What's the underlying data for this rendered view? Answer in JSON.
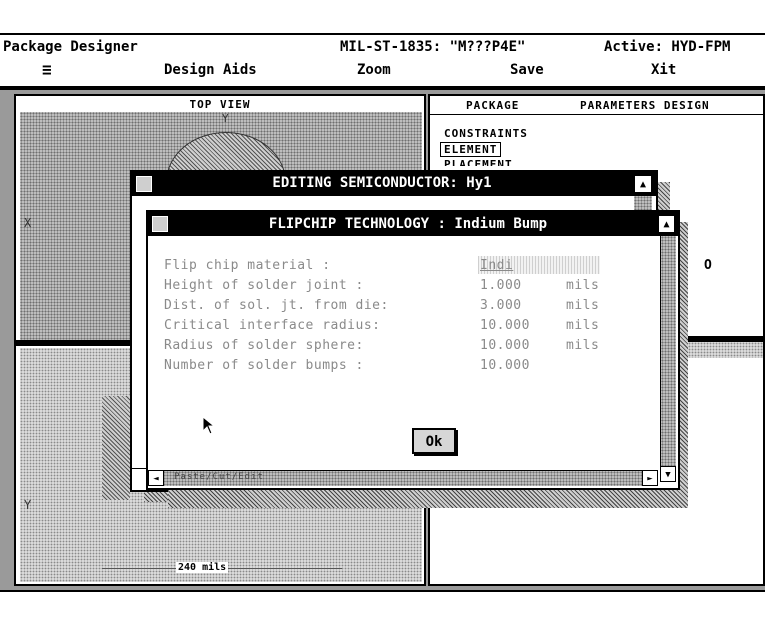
{
  "app": {
    "title": "Package Designer",
    "spec": "MIL-ST-1835: \"M???P4E\"",
    "active": "Active: HYD-FPM"
  },
  "menu": {
    "system_glyph": "≡",
    "items": [
      "Design Aids",
      "Zoom",
      "Save",
      "Xit"
    ]
  },
  "top_view": {
    "title": "TOP VIEW",
    "axis_y_top": "Y",
    "axis_x": "X",
    "axis_y_bottom": "Y",
    "scale": "240 mils"
  },
  "right_panel": {
    "tabs": [
      "PACKAGE",
      "PARAMETERS DESIGN"
    ],
    "items": [
      "CONSTRAINTS",
      "ELEMENT",
      "PLACEMENT"
    ],
    "marker": "O"
  },
  "outer_dialog": {
    "title": "EDITING SEMICONDUCTOR: Hy1",
    "status": "Paste/Cut/Edit"
  },
  "inner_dialog": {
    "title": "FLIPCHIP TECHNOLOGY : Indium Bump",
    "rows": [
      {
        "label": "Flip chip material :",
        "value": "Indi",
        "unit": ""
      },
      {
        "label": "Height of solder joint :",
        "value": "1.000",
        "unit": "mils"
      },
      {
        "label": "Dist. of sol. jt. from die:",
        "value": "3.000",
        "unit": "mils"
      },
      {
        "label": "Critical interface radius:",
        "value": "10.000",
        "unit": "mils"
      },
      {
        "label": "Radius of solder sphere:",
        "value": "10.000",
        "unit": "mils"
      },
      {
        "label": "Number of solder bumps :",
        "value": "10.000",
        "unit": ""
      }
    ],
    "ok_label": "Ok"
  }
}
